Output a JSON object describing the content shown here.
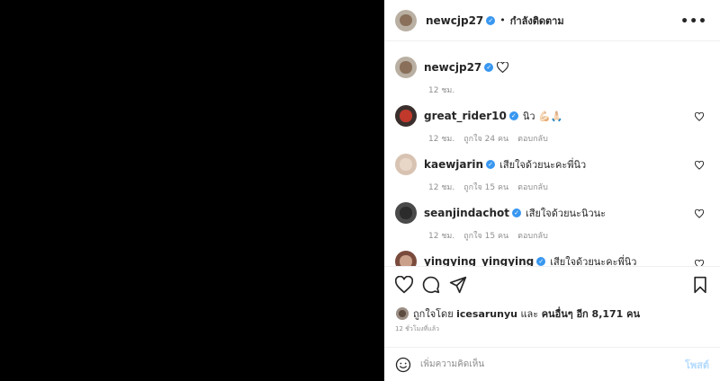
{
  "header": {
    "username": "newcjp27",
    "dot": "•",
    "follow_status": "กำลังติดตาม",
    "more": "•••"
  },
  "caption": {
    "username": "newcjp27",
    "time": "12 ชม."
  },
  "comments": [
    {
      "username": "great_rider10",
      "text": "นิว 💪🏻🙏🏻",
      "time": "12 ชม.",
      "likes": "ถูกใจ 24 คน",
      "reply": "ตอบกลับ",
      "avatar_color": "#3a2f2c"
    },
    {
      "username": "kaewjarin",
      "text": "เสียใจด้วยนะคะพี่นิว",
      "time": "12 ชม.",
      "likes": "ถูกใจ 15 คน",
      "reply": "ตอบกลับ",
      "avatar_color": "#d8c3b2"
    },
    {
      "username": "seanjindachot",
      "text": "เสียใจด้วยนะนิวนะ",
      "time": "12 ชม.",
      "likes": "ถูกใจ 15 คน",
      "reply": "ตอบกลับ",
      "avatar_color": "#4a4a4a"
    },
    {
      "username": "yingying_yingying",
      "text": "เสียใจด้วยนะคะพี่นิว",
      "avatar_color": "#7a4b3c"
    }
  ],
  "likes": {
    "prefix": "ถูกใจโดย",
    "user": "icesarunyu",
    "and": "และ",
    "others": "คนอื่นๆ อีก 8,171 คน"
  },
  "timestamp": "12 ชั่วโมงที่แล้ว",
  "add_comment": {
    "placeholder": "เพิ่มความคิดเห็น",
    "post": "โพสต์"
  },
  "colors": {
    "verified": "#3897f0",
    "post_disabled": "#b3dbff",
    "muted": "#8e8e8e"
  }
}
